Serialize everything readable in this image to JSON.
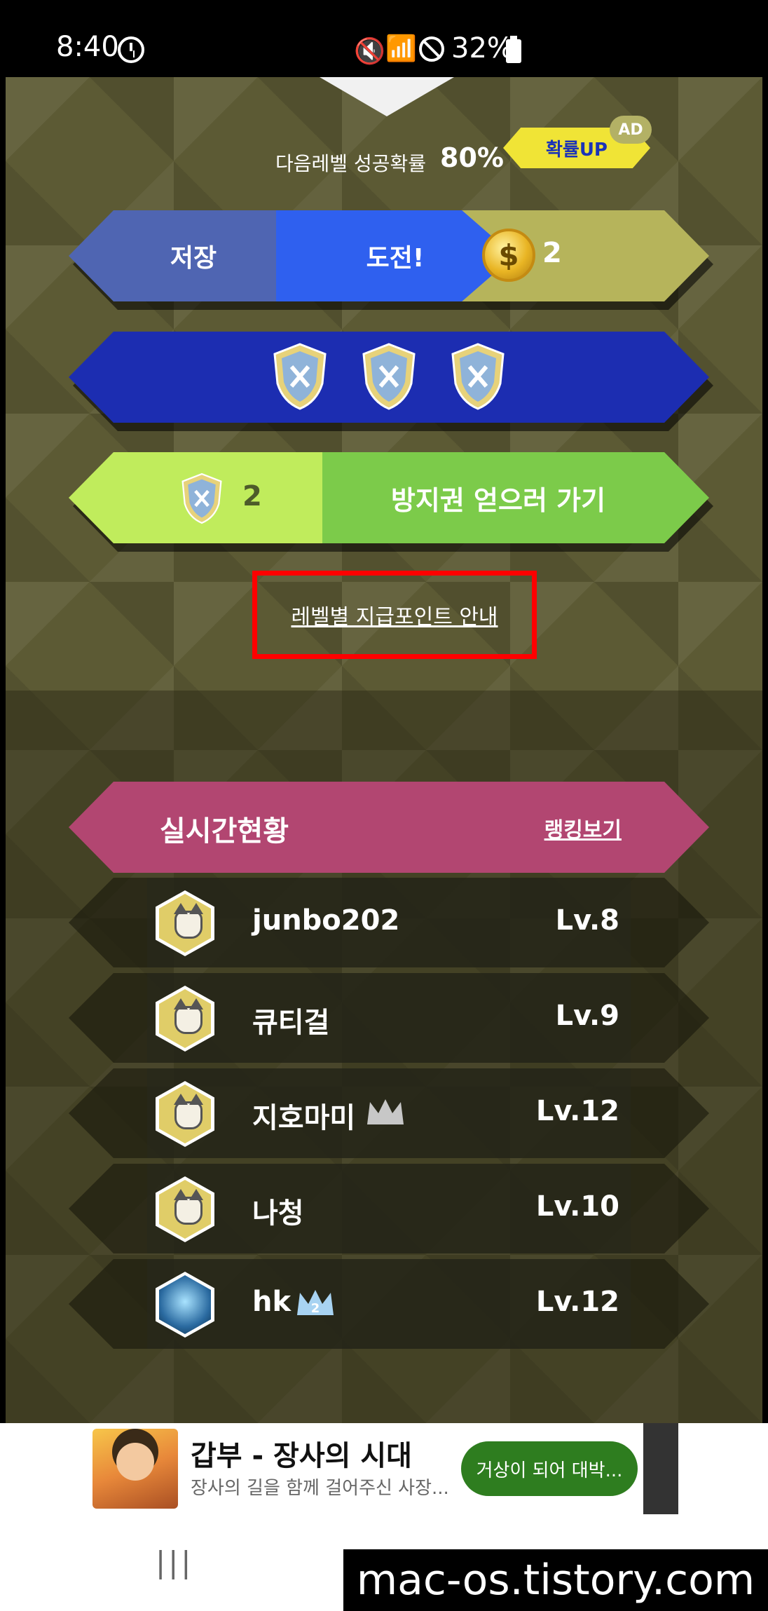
{
  "status_bar": {
    "time": "8:40",
    "battery": "32%"
  },
  "game": {
    "next_level_label": "다음레벨 성공확률",
    "next_level_value": "80%",
    "prob_up_label": "확률UP",
    "ad_badge": "AD",
    "save_label": "저장",
    "challenge_label": "도전!",
    "coin_count": "2",
    "shield_count": "2",
    "get_shield_label": "방지권 얻으러 가기",
    "guide_link": "레벨별 지급포인트 안내"
  },
  "ranking": {
    "title": "실시간현황",
    "view_link": "랭킹보기",
    "rows": [
      {
        "name": "junbo202",
        "level": "Lv.8",
        "crown": ""
      },
      {
        "name": "큐티걸",
        "level": "Lv.9",
        "crown": ""
      },
      {
        "name": "지호마미",
        "level": "Lv.12",
        "crown": "gray"
      },
      {
        "name": "나청",
        "level": "Lv.10",
        "crown": ""
      },
      {
        "name": "hk",
        "level": "Lv.12",
        "crown": "2"
      }
    ]
  },
  "ad": {
    "title": "갑부 - 장사의 시대",
    "description": "장사의 길을 함께 걸어주신 사장...",
    "cta": "거상이 되어 대박..."
  },
  "nav": {
    "recent_icon": "|||"
  },
  "watermark": "mac-os.tistory.com",
  "colors": {
    "accent": "#2f60ef",
    "rank_header": "#b24671",
    "shield_bar": "#1c2db1",
    "get_button": "#7ccb4a"
  }
}
